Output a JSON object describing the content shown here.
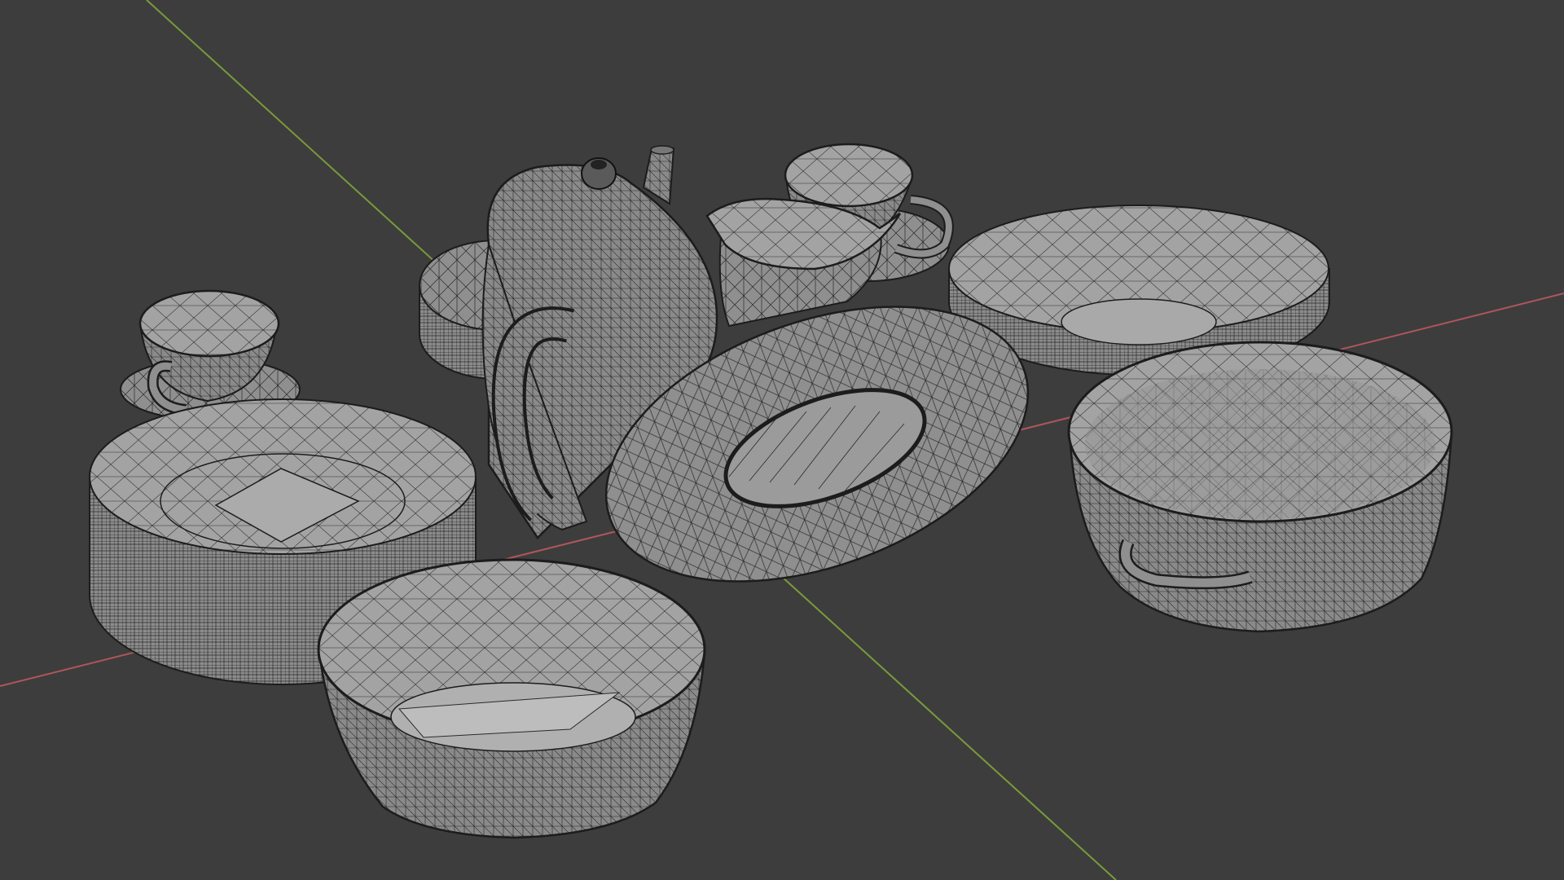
{
  "viewport": {
    "mode": "wireframe-on-shaded",
    "background": "#3d3d3d",
    "x_axis_color": "#b0555d",
    "y_axis_color": "#7a9a3a",
    "mesh_fill": "#8f8f8f",
    "wire_color": "#1c1c1c"
  },
  "scene_objects": [
    "teapot",
    "creamer-jug",
    "teacup-back",
    "saucer-back",
    "plate-stack-back",
    "teacup-left",
    "saucer-left",
    "plate-stack-left",
    "oval-platter",
    "plate-stack-right",
    "bowl-front",
    "bowl-right"
  ]
}
